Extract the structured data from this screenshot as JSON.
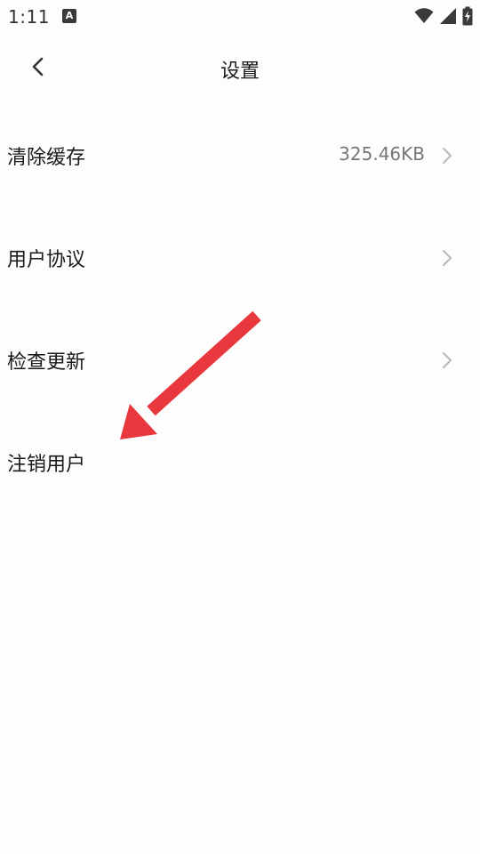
{
  "status_bar": {
    "time": "1:11",
    "notification_icon": "A",
    "icons": [
      "wifi-icon",
      "signal-icon",
      "battery-charging-icon"
    ]
  },
  "header": {
    "title": "设置",
    "back_icon": "chevron-left-icon"
  },
  "settings": {
    "items": [
      {
        "label": "清除缓存",
        "value": "325.46KB",
        "has_chevron": true
      },
      {
        "label": "用户协议",
        "value": "",
        "has_chevron": true
      },
      {
        "label": "检查更新",
        "value": "",
        "has_chevron": true
      },
      {
        "label": "注销用户",
        "value": "",
        "has_chevron": false
      }
    ]
  },
  "annotation": {
    "type": "red-arrow",
    "color": "#e8383d",
    "points_to": "注销用户"
  },
  "colors": {
    "background": "#fdfdfd",
    "text": "#1a1a1a",
    "secondary_text": "#777777",
    "chevron": "#b8b8b8",
    "arrow": "#e8383d"
  }
}
